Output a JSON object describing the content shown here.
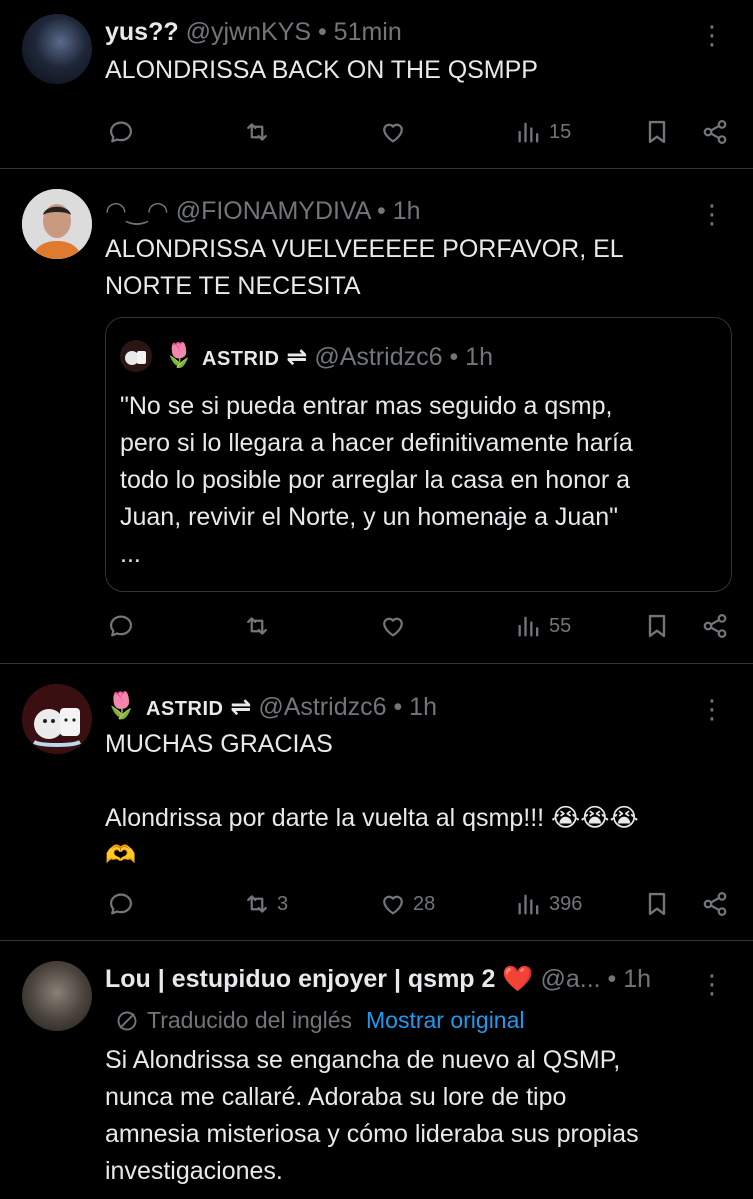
{
  "posts": [
    {
      "name": "yus??",
      "handle": "@yjwnKYS",
      "time": "51min",
      "text": "ALONDRISSA BACK ON THE QSMPP",
      "stats": {
        "replies": "",
        "reposts": "",
        "likes": "",
        "views": "15"
      }
    },
    {
      "name": "",
      "name_emoji": "◠‿◠",
      "handle": "@FIONAMYDIVA",
      "time": "1h",
      "text_lines": [
        "ALONDRISSA VUELVEEEEE PORFAVOR, EL",
        "NORTE TE NECESITA"
      ],
      "quote": {
        "name": "ASTRID",
        "handle": "@Astridzc6",
        "time": "1h",
        "lines": [
          "\"No se si pueda entrar mas seguido a qsmp,",
          "pero si lo llegara a hacer definitivamente haría",
          "todo lo posible por arreglar la casa en honor a",
          "Juan, revivir el Norte, y un homenaje a Juan\"",
          "..."
        ]
      },
      "stats": {
        "replies": "",
        "reposts": "",
        "likes": "",
        "views": "55"
      }
    },
    {
      "name": "ASTRID",
      "handle": "@Astridzc6",
      "time": "1h",
      "line1": "MUCHAS GRACIAS",
      "line2": "Alondrissa por darte la vuelta al qsmp!!! 😭😭😭",
      "line3": "🫶",
      "stats": {
        "replies": "",
        "reposts": "3",
        "likes": "28",
        "views": "396"
      }
    },
    {
      "name": "Lou | estupiduo enjoyer | qsmp 2",
      "heart": "❤️",
      "handle": "@a...",
      "time": "1h",
      "translated": "Traducido del inglés",
      "show_original": "Mostrar original",
      "lines": [
        "Si Alondrissa se engancha de nuevo al QSMP,",
        "nunca me callaré. Adoraba su lore de tipo",
        "amnesia misteriosa y cómo lideraba sus propias",
        "investigaciones."
      ]
    }
  ],
  "dot": "•",
  "more": "⋮",
  "colors": {
    "background": "#000000",
    "muted": "#71767b",
    "link": "#1d9bf0",
    "text": "#e7e9ea"
  },
  "icons": [
    "reply-icon",
    "repost-icon",
    "like-icon",
    "views-icon",
    "bookmark-icon",
    "share-icon"
  ]
}
